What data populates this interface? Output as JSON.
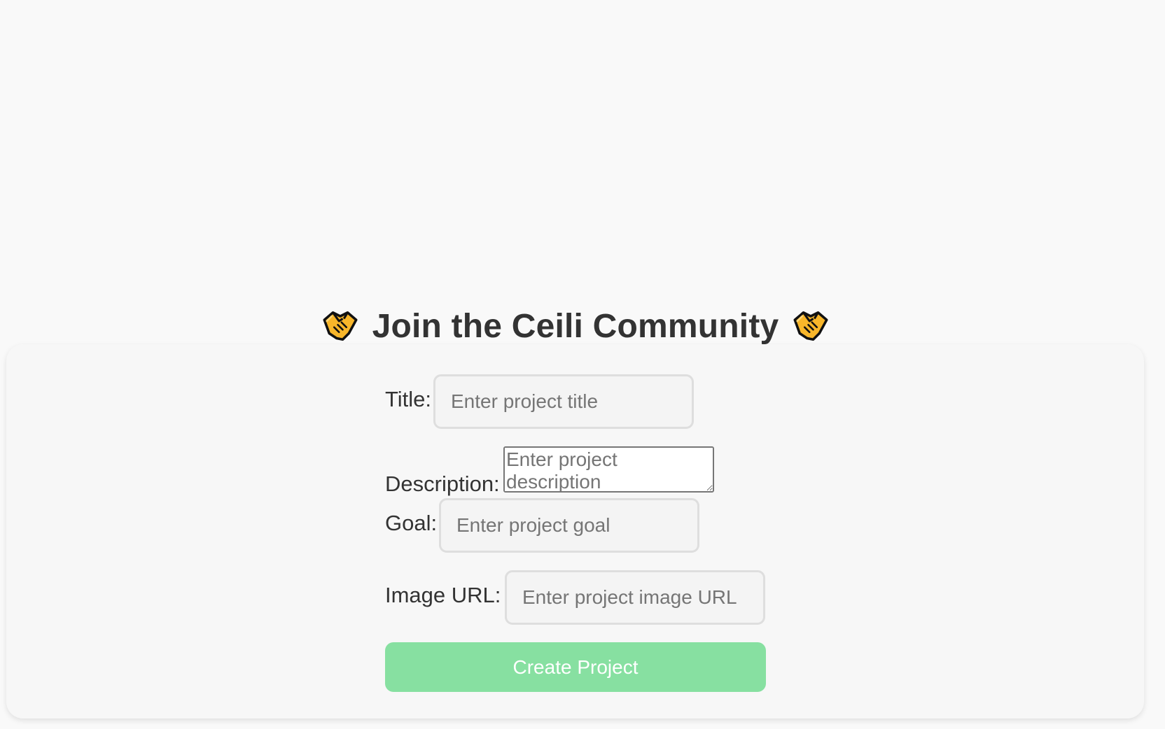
{
  "form": {
    "heading": "Join the Ceili Community",
    "heading_icon": "handshake-icon",
    "accent_color": "#87e0a1",
    "fields": {
      "title": {
        "label": "Title:",
        "placeholder": "Enter project title",
        "value": ""
      },
      "description": {
        "label": "Description:",
        "placeholder": "Enter project description",
        "value": ""
      },
      "goal": {
        "label": "Goal:",
        "placeholder": "Enter project goal",
        "value": ""
      },
      "image_url": {
        "label": "Image URL:",
        "placeholder": "Enter project image URL",
        "value": ""
      }
    },
    "submit_label": "Create Project"
  }
}
